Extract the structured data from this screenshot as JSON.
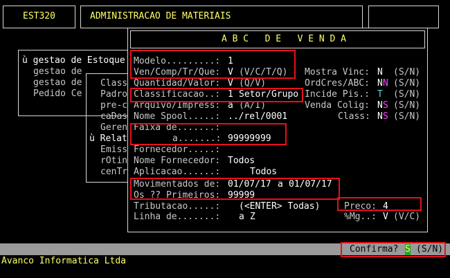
{
  "header": {
    "program_code": "EST320",
    "title": "ADMINISTRACAO DE MATERIAIS"
  },
  "background_menu": {
    "main_items": [
      "ù gestao de Estoque",
      "gestao de",
      "gestao de",
      "Pedido Ce"
    ],
    "sub_items": [
      "Class",
      "Padro",
      "pre-c",
      "caDas",
      "Geren",
      "ù Relat",
      "Emiss",
      "rOtin",
      "cenTr"
    ]
  },
  "dialog": {
    "title": "A B C   D E   V E N D A",
    "fields": {
      "modelo": {
        "label": "Modelo.........:",
        "value": "1"
      },
      "ven_comp": {
        "label": "Ven/Comp/Tr/Que:",
        "value": "V",
        "hint": "(V/C/T/Q)"
      },
      "quantidade": {
        "label": "Quantidad/Valor:",
        "value": "V",
        "hint": "(Q/V)"
      },
      "classificacao": {
        "label": "Classificacao..:",
        "value": "1",
        "desc": "Setor/Grupo"
      },
      "arquivo": {
        "label": "Arquivo/Impress:",
        "value": "a",
        "hint": "(A/I)"
      },
      "nome_spool": {
        "label": "Nome Spool.....:",
        "value": "../rel/0001"
      },
      "faixa_de": {
        "label": "Faixa de.......:",
        "value": ""
      },
      "faixa_a": {
        "label": "a.......:",
        "value": "99999999"
      },
      "fornecedor": {
        "label": "Fornecedor.....:",
        "value": ""
      },
      "nome_fornecedor": {
        "label": "Nome Fornecedor:",
        "value": "Todos"
      },
      "aplicacao": {
        "label": "Aplicacao......:",
        "value": "Todos"
      },
      "movimentados": {
        "label": "Movimentados de:",
        "from": "01/07/17",
        "sep": "a",
        "to": "01/07/17"
      },
      "os_primeiros": {
        "label": "Os ?? Primeiros:",
        "value": "99999"
      },
      "tributacao": {
        "label": "Tributacao.....:",
        "value": "(<ENTER> Todas)"
      },
      "linha_de": {
        "label": "Linha de.......:",
        "from": "a",
        "to": "Z"
      }
    },
    "right_fields": {
      "mostra_vinc": {
        "label": "Mostra Vinc:",
        "value": "N",
        "hint": "(S/N)"
      },
      "ordcres": {
        "label": "OrdCres/ABC:",
        "value_first": "N",
        "value_second": "N",
        "hint": "(S/N)"
      },
      "incide_pis": {
        "label": "Incide Pis.:",
        "value": "T",
        "hint": "(S/N)"
      },
      "venda_colig": {
        "label": "Venda Colig:",
        "value_first": "N",
        "value_second": "S",
        "hint": "(S/N)"
      },
      "class": {
        "label": "Class:",
        "value_first": "N",
        "value_second": "S",
        "hint": "(S/N)"
      },
      "preco": {
        "label": "Preco:",
        "value": "4"
      },
      "mg": {
        "label": "%Mg..:",
        "value": "V",
        "hint": "(V/C)"
      }
    }
  },
  "status_bar": {
    "prompt": "Confirma?",
    "value": "S",
    "hint": "(S/N)"
  },
  "footer": {
    "company": "Avanco Informatica Ltda"
  },
  "colors": {
    "highlight_box": "#e8101a",
    "label_yellow": "#ffff66",
    "value_white": "#ffffff"
  }
}
